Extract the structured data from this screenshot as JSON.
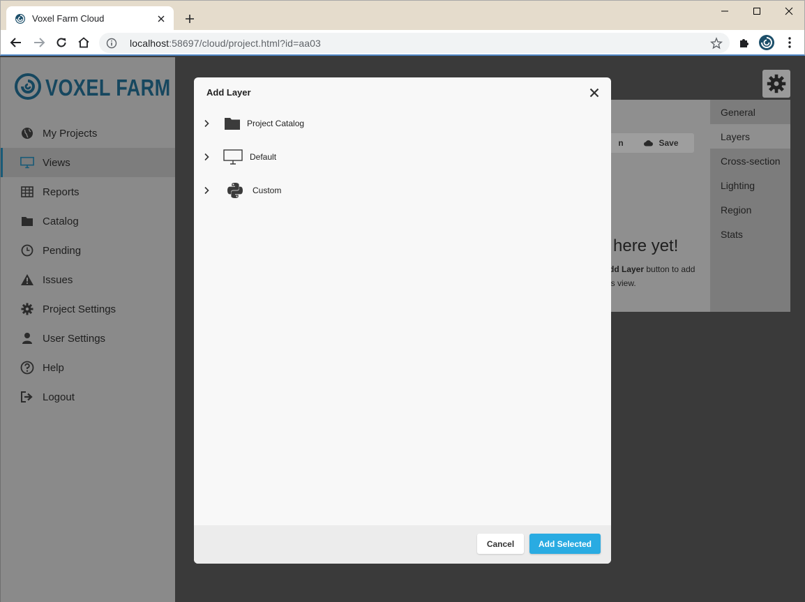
{
  "browser": {
    "tab_title": "Voxel Farm Cloud",
    "url_host": "localhost",
    "url_rest": ":58697/cloud/project.html?id=aa03"
  },
  "sidebar": {
    "brand_first": "VOXEL",
    "brand_second": "FARM",
    "brand_color": "#16475f",
    "items": [
      {
        "label": "My Projects",
        "icon": "globe-icon"
      },
      {
        "label": "Views",
        "icon": "monitor-icon"
      },
      {
        "label": "Reports",
        "icon": "table-icon"
      },
      {
        "label": "Catalog",
        "icon": "folder-icon"
      },
      {
        "label": "Pending",
        "icon": "clock-icon"
      },
      {
        "label": "Issues",
        "icon": "warning-icon"
      },
      {
        "label": "Project Settings",
        "icon": "gear-icon"
      },
      {
        "label": "User Settings",
        "icon": "user-icon"
      },
      {
        "label": "Help",
        "icon": "help-icon"
      },
      {
        "label": "Logout",
        "icon": "logout-icon"
      }
    ],
    "active_index": 1
  },
  "background_panel": {
    "hidden_button_fragment": "n",
    "save_label": "Save",
    "empty_title": "here yet!",
    "empty_line1_bold": "dd Layer",
    "empty_line1_rest": " button to add",
    "empty_line2": "is view.",
    "side_tabs": [
      "General",
      "Layers",
      "Cross-section",
      "Lighting",
      "Region",
      "Stats"
    ],
    "active_side_tab": 1
  },
  "modal": {
    "title": "Add Layer",
    "tree": [
      {
        "label": "Project Catalog",
        "icon": "folder-icon"
      },
      {
        "label": "Default",
        "icon": "monitor-icon"
      },
      {
        "label": "Custom",
        "icon": "python-icon"
      }
    ],
    "cancel_label": "Cancel",
    "primary_label": "Add Selected",
    "primary_color": "#29abe2"
  }
}
